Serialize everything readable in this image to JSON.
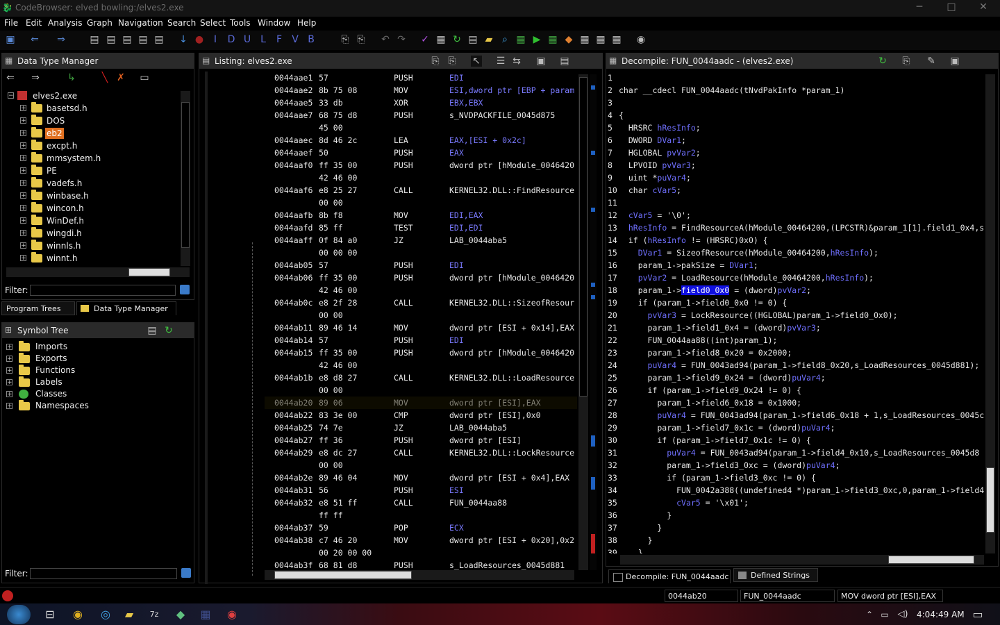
{
  "window": {
    "title": "CodeBrowser: elved bowling:/elves2.exe",
    "minimize": "─",
    "maximize": "□",
    "close": "✕"
  },
  "menu": [
    "File",
    "Edit",
    "Analysis",
    "Graph",
    "Navigation",
    "Search",
    "Select",
    "Tools",
    "Window",
    "Help"
  ],
  "data_type_manager": {
    "title": "Data Type Manager",
    "root": "elves2.exe",
    "items": [
      "basetsd.h",
      "DOS",
      "eb2",
      "excpt.h",
      "mmsystem.h",
      "PE",
      "vadefs.h",
      "winbase.h",
      "wincon.h",
      "WinDef.h",
      "wingdi.h",
      "winnls.h",
      "winnt.h"
    ],
    "selected": "eb2",
    "filter_label": "Filter:",
    "filter_value": "",
    "tabs": [
      "Program Trees",
      "Data Type Manager"
    ]
  },
  "symbol_tree": {
    "title": "Symbol Tree",
    "items": [
      "Imports",
      "Exports",
      "Functions",
      "Labels",
      "Classes",
      "Namespaces"
    ],
    "filter_label": "Filter:",
    "filter_value": ""
  },
  "listing": {
    "title": "Listing:  elves2.exe",
    "rows": [
      {
        "addr": "0044aae1",
        "bytes": "57",
        "mn": "PUSH",
        "op": "EDI"
      },
      {
        "addr": "0044aae2",
        "bytes": "8b 75 08",
        "mn": "MOV",
        "op": "ESI,dword ptr [EBP + param"
      },
      {
        "addr": "0044aae5",
        "bytes": "33 db",
        "mn": "XOR",
        "op": "EBX,EBX"
      },
      {
        "addr": "0044aae7",
        "bytes": "68 75 d8",
        "mn": "PUSH",
        "op": "s_NVDPACKFILE_0045d875"
      },
      {
        "addr": "",
        "bytes": "45 00",
        "mn": "",
        "op": ""
      },
      {
        "addr": "0044aaec",
        "bytes": "8d 46 2c",
        "mn": "LEA",
        "op": "EAX,[ESI + 0x2c]"
      },
      {
        "addr": "0044aaef",
        "bytes": "50",
        "mn": "PUSH",
        "op": "EAX"
      },
      {
        "addr": "0044aaf0",
        "bytes": "ff 35 00",
        "mn": "PUSH",
        "op": "dword ptr [hModule_0046420"
      },
      {
        "addr": "",
        "bytes": "42 46 00",
        "mn": "",
        "op": ""
      },
      {
        "addr": "0044aaf6",
        "bytes": "e8 25 27",
        "mn": "CALL",
        "op": "KERNEL32.DLL::FindResource"
      },
      {
        "addr": "",
        "bytes": "00 00",
        "mn": "",
        "op": ""
      },
      {
        "addr": "0044aafb",
        "bytes": "8b f8",
        "mn": "MOV",
        "op": "EDI,EAX"
      },
      {
        "addr": "0044aafd",
        "bytes": "85 ff",
        "mn": "TEST",
        "op": "EDI,EDI"
      },
      {
        "addr": "0044aaff",
        "bytes": "0f 84 a0",
        "mn": "JZ",
        "op": "LAB_0044aba5"
      },
      {
        "addr": "",
        "bytes": "00 00 00",
        "mn": "",
        "op": ""
      },
      {
        "addr": "0044ab05",
        "bytes": "57",
        "mn": "PUSH",
        "op": "EDI"
      },
      {
        "addr": "0044ab06",
        "bytes": "ff 35 00",
        "mn": "PUSH",
        "op": "dword ptr [hModule_0046420"
      },
      {
        "addr": "",
        "bytes": "42 46 00",
        "mn": "",
        "op": ""
      },
      {
        "addr": "0044ab0c",
        "bytes": "e8 2f 28",
        "mn": "CALL",
        "op": "KERNEL32.DLL::SizeofResour"
      },
      {
        "addr": "",
        "bytes": "00 00",
        "mn": "",
        "op": ""
      },
      {
        "addr": "0044ab11",
        "bytes": "89 46 14",
        "mn": "MOV",
        "op": "dword ptr [ESI + 0x14],EAX"
      },
      {
        "addr": "0044ab14",
        "bytes": "57",
        "mn": "PUSH",
        "op": "EDI"
      },
      {
        "addr": "0044ab15",
        "bytes": "ff 35 00",
        "mn": "PUSH",
        "op": "dword ptr [hModule_0046420"
      },
      {
        "addr": "",
        "bytes": "42 46 00",
        "mn": "",
        "op": ""
      },
      {
        "addr": "0044ab1b",
        "bytes": "e8 d8 27",
        "mn": "CALL",
        "op": "KERNEL32.DLL::LoadResource"
      },
      {
        "addr": "",
        "bytes": "00 00",
        "mn": "",
        "op": ""
      },
      {
        "addr": "0044ab20",
        "bytes": "89 06",
        "mn": "MOV",
        "op": "dword ptr [ESI],EAX"
      },
      {
        "addr": "0044ab22",
        "bytes": "83 3e 00",
        "mn": "CMP",
        "op": "dword ptr [ESI],0x0"
      },
      {
        "addr": "0044ab25",
        "bytes": "74 7e",
        "mn": "JZ",
        "op": "LAB_0044aba5"
      },
      {
        "addr": "0044ab27",
        "bytes": "ff 36",
        "mn": "PUSH",
        "op": "dword ptr [ESI]"
      },
      {
        "addr": "0044ab29",
        "bytes": "e8 dc 27",
        "mn": "CALL",
        "op": "KERNEL32.DLL::LockResource"
      },
      {
        "addr": "",
        "bytes": "00 00",
        "mn": "",
        "op": ""
      },
      {
        "addr": "0044ab2e",
        "bytes": "89 46 04",
        "mn": "MOV",
        "op": "dword ptr [ESI + 0x4],EAX"
      },
      {
        "addr": "0044ab31",
        "bytes": "56",
        "mn": "PUSH",
        "op": "ESI"
      },
      {
        "addr": "0044ab32",
        "bytes": "e8 51 ff",
        "mn": "CALL",
        "op": "FUN_0044aa88"
      },
      {
        "addr": "",
        "bytes": "ff ff",
        "mn": "",
        "op": ""
      },
      {
        "addr": "0044ab37",
        "bytes": "59",
        "mn": "POP",
        "op": "ECX"
      },
      {
        "addr": "0044ab38",
        "bytes": "c7 46 20",
        "mn": "MOV",
        "op": "dword ptr [ESI + 0x20],0x2"
      },
      {
        "addr": "",
        "bytes": "00 20 00 00",
        "mn": "",
        "op": ""
      },
      {
        "addr": "0044ab3f",
        "bytes": "68 81 d8",
        "mn": "PUSH",
        "op": "s_LoadResources_0045d881"
      }
    ]
  },
  "decompile": {
    "title": "Decompile: FUN_0044aadc - (elves2.exe)",
    "highlight": "field0_0x0",
    "lines": [
      "",
      "char __cdecl FUN_0044aadc(tNvdPakInfo *param_1)",
      "",
      "{",
      "  HRSRC hResInfo;",
      "  DWORD DVar1;",
      "  HGLOBAL pvVar2;",
      "  LPVOID pvVar3;",
      "  uint *puVar4;",
      "  char cVar5;",
      "",
      "  cVar5 = '\\0';",
      "  hResInfo = FindResourceA(hModule_00464200,(LPCSTR)&param_1[1].field1_0x4,s",
      "  if (hResInfo != (HRSRC)0x0) {",
      "    DVar1 = SizeofResource(hModule_00464200,hResInfo);",
      "    param_1->pakSize = DVar1;",
      "    pvVar2 = LoadResource(hModule_00464200,hResInfo);",
      "    param_1->field0_0x0 = (dword)pvVar2;",
      "    if (param_1->field0_0x0 != 0) {",
      "      pvVar3 = LockResource((HGLOBAL)param_1->field0_0x0);",
      "      param_1->field1_0x4 = (dword)pvVar3;",
      "      FUN_0044aa88((int)param_1);",
      "      param_1->field8_0x20 = 0x2000;",
      "      puVar4 = FUN_0043ad94(param_1->field8_0x20,s_LoadResources_0045d881);",
      "      param_1->field9_0x24 = (dword)puVar4;",
      "      if (param_1->field9_0x24 != 0) {",
      "        param_1->field6_0x18 = 0x1000;",
      "        puVar4 = FUN_0043ad94(param_1->field6_0x18 + 1,s_LoadResources_0045c",
      "        param_1->field7_0x1c = (dword)puVar4;",
      "        if (param_1->field7_0x1c != 0) {",
      "          puVar4 = FUN_0043ad94(param_1->field4_0x10,s_LoadResources_0045d8",
      "          param_1->field3_0xc = (dword)puVar4;",
      "          if (param_1->field3_0xc != 0) {",
      "            FUN_0042a388((undefined4 *)param_1->field3_0xc,0,param_1->field4",
      "            cVar5 = '\\x01';",
      "          }",
      "        }",
      "      }",
      "    }"
    ],
    "tabs": [
      "Decompile: FUN_0044aadc",
      "Defined Strings"
    ]
  },
  "status": {
    "address": "0044ab20",
    "function": "FUN_0044aadc",
    "instruction": "MOV dword ptr [ESI],EAX"
  },
  "taskbar": {
    "clock": "4:04:49 AM"
  },
  "colors": {
    "accent_blue": "#6a6aff",
    "highlight": "#1010e0",
    "folder": "#e8c848"
  }
}
